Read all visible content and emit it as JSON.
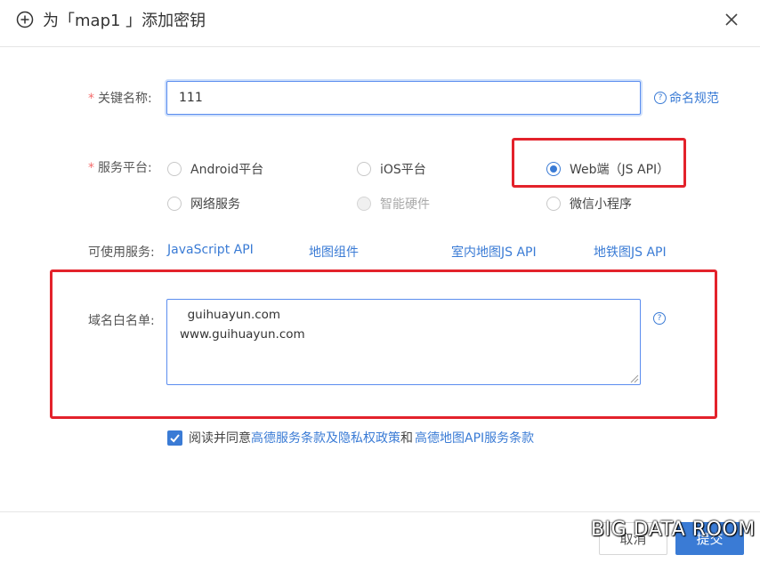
{
  "dialog": {
    "title": "为「map1 」添加密钥",
    "close_icon": "close-icon",
    "add_icon": "circle-plus-icon"
  },
  "form": {
    "key_name_label": "关键名称:",
    "key_name_value": "111",
    "naming_rules_link": "命名规范",
    "platform_label": "服务平台:",
    "platforms": [
      {
        "label": "Android平台",
        "checked": false,
        "disabled": false
      },
      {
        "label": "iOS平台",
        "checked": false,
        "disabled": false
      },
      {
        "label": "Web端（JS API）",
        "checked": true,
        "disabled": false
      },
      {
        "label": "网络服务",
        "checked": false,
        "disabled": false
      },
      {
        "label": "智能硬件",
        "checked": false,
        "disabled": true
      },
      {
        "label": "微信小程序",
        "checked": false,
        "disabled": false
      }
    ],
    "available_services_label": "可使用服务:",
    "available_services": [
      "JavaScript API",
      "地图组件",
      "室内地图JS API",
      "地铁图JS API"
    ],
    "whitelist_label": "域名白名单:",
    "whitelist_value": "  guihuayun.com\nwww.guihuayun.com",
    "agree_prefix": "阅读并同意",
    "agree_link1": "高德服务条款及隐私权政策",
    "agree_mid": " 和",
    "agree_link2": "高德地图API服务条款",
    "agree_checked": true
  },
  "footer": {
    "cancel_label": "取消",
    "submit_label": "提交"
  },
  "watermark": "BIG DATA ROOM",
  "colors": {
    "accent": "#3a7bd5",
    "highlight": "#e3222b",
    "required": "#f56c6c"
  }
}
